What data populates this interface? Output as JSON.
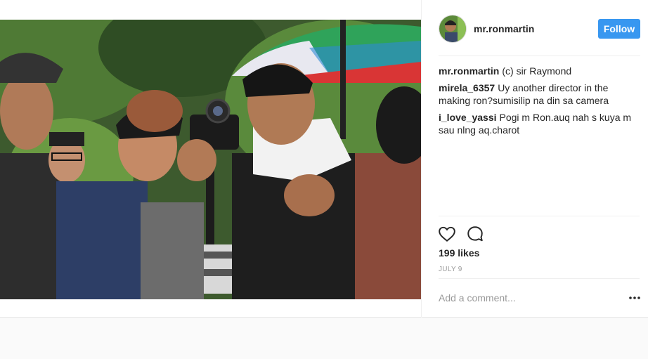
{
  "post": {
    "username": "mr.ronmartin",
    "follow_label": "Follow",
    "likes": "199 likes",
    "date": "JULY 9",
    "comment_placeholder": "Add a comment...",
    "more_icon": "ellipsis-icon",
    "comments": [
      {
        "user": "mr.ronmartin",
        "text": "(c) sir Raymond"
      },
      {
        "user": "mirela_6357",
        "text": "Uy another director in the making ron?sumisilip na din sa camera"
      },
      {
        "user": "i_love_yassi",
        "text": "Pogi m Ron.auq nah s kuya m sau nlng aq.charot"
      }
    ]
  },
  "colors": {
    "follow_bg": "#3897f0",
    "text": "#262626",
    "muted": "#999999"
  }
}
